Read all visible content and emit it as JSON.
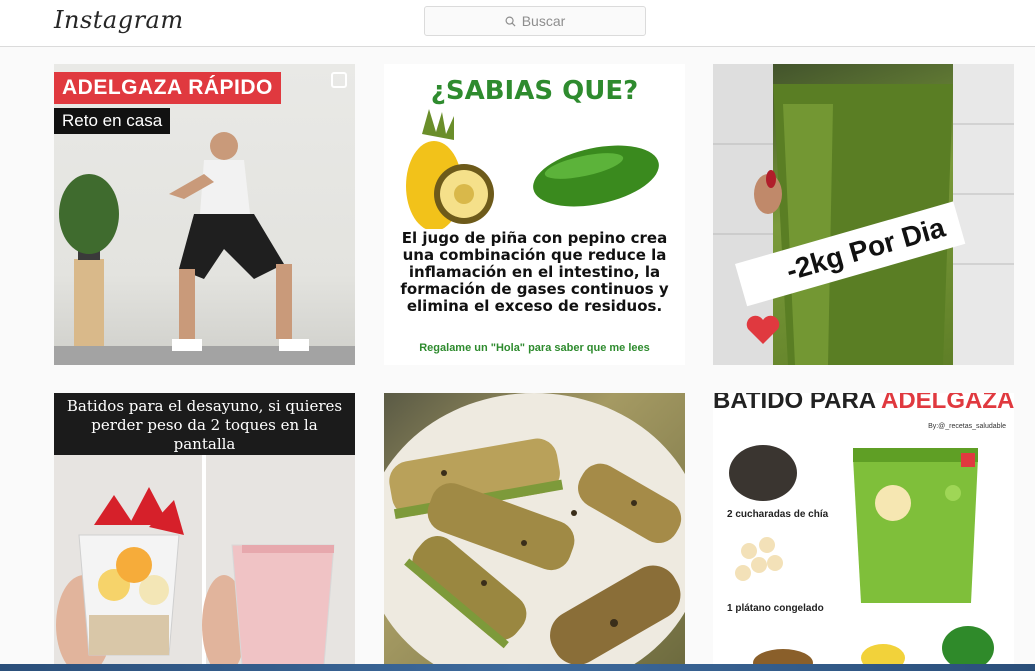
{
  "header": {
    "logo": "Instagram",
    "search_placeholder": "Buscar"
  },
  "posts": [
    {
      "badge": "ADELGAZA RÁPIDO",
      "subtitle": "Reto en casa"
    },
    {
      "heading": "¿SABIAS QUE?",
      "body": "El jugo de piña con pepino crea una combinación que reduce la inflamación en el intestino, la formación de gases continuos y elimina el exceso de residuos.",
      "footer": "Regalame un \"Hola\" para saber que me lees"
    },
    {
      "overlay": "-2kg Por Dia"
    },
    {
      "caption": "Batidos para el desayuno, si quieres perder peso da 2 toques en la pantalla"
    },
    {
      "alt": ""
    },
    {
      "heading_a": "BATIDO PARA ",
      "heading_b": "ADELGAZAR",
      "handle": "By:@_recetas_saludable",
      "ingredient1": "2 cucharadas de chía",
      "ingredient2": "1 plátano congelado"
    }
  ],
  "colors": {
    "brand_red": "#e0393f",
    "green": "#2e8b2e"
  }
}
